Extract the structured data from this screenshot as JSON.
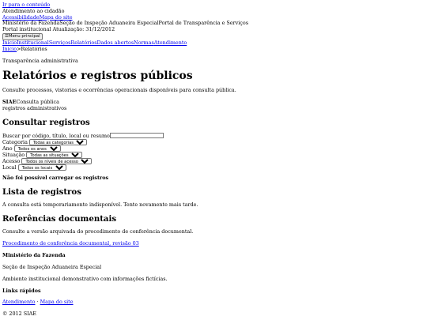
{
  "skip_link": "Ir para o conteúdo",
  "header": {
    "service": "Atendimento ao cidadão",
    "utility_links": [
      "Acessibilidade",
      "Mapa do site"
    ],
    "agencies": [
      "Ministério da Fazenda",
      "Seção de Inspeção Aduaneira Especial",
      "Portal de Transparência e Serviços"
    ],
    "portal_label": "Portal institucional",
    "updated": "Atualização: 31/12/2012",
    "menu_button": "☰Menu principal"
  },
  "nav": [
    "Início",
    "Institucional",
    "Serviços",
    "Relatórios",
    "Dados abertos",
    "Normas",
    "Atendimento"
  ],
  "breadcrumb": {
    "home": "Início",
    "separator": ">",
    "current": "Relatórios"
  },
  "main": {
    "eyebrow": "Transparência administrativa",
    "title": "Relatórios e registros públicos",
    "intro": "Consulte processos, vistorias e ocorrências operacionais disponíveis para consulta pública.",
    "meta_strong": "SIAE",
    "meta_text": "Consulta pública",
    "meta_line2": "registros administrativos"
  },
  "search": {
    "heading": "Consultar registros",
    "query_label": "Buscar por código, título, local ou resumo",
    "query_value": "",
    "filters": [
      {
        "label": "Categoria",
        "selected": "Todas as categorias"
      },
      {
        "label": "Ano",
        "selected": "Todos os anos"
      },
      {
        "label": "Situação",
        "selected": "Todas as situações"
      },
      {
        "label": "Acesso",
        "selected": "Todos os níveis de acesso"
      },
      {
        "label": "Local",
        "selected": "Todos os locais"
      }
    ],
    "error": "Não foi possível carregar os registros"
  },
  "records": {
    "heading": "Lista de registros",
    "message": "A consulta está temporariamente indisponível. Tente novamente mais tarde."
  },
  "references": {
    "heading": "Referências documentais",
    "text": "Consulte a versão arquivada do procedimento de conferência documental.",
    "link": "Procedimento de conferência documental, revisão 03"
  },
  "footer": {
    "org": "Ministério da Fazenda",
    "section": "Seção de Inspeção Aduaneira Especial",
    "note": "Ambiente institucional demonstrativo com informações fictícias.",
    "quick_title": "Links rápidos",
    "quick_links": [
      "Atendimento",
      "Mapa do site"
    ],
    "quick_sep": " · ",
    "copyright": "© 2012 SIAE"
  }
}
